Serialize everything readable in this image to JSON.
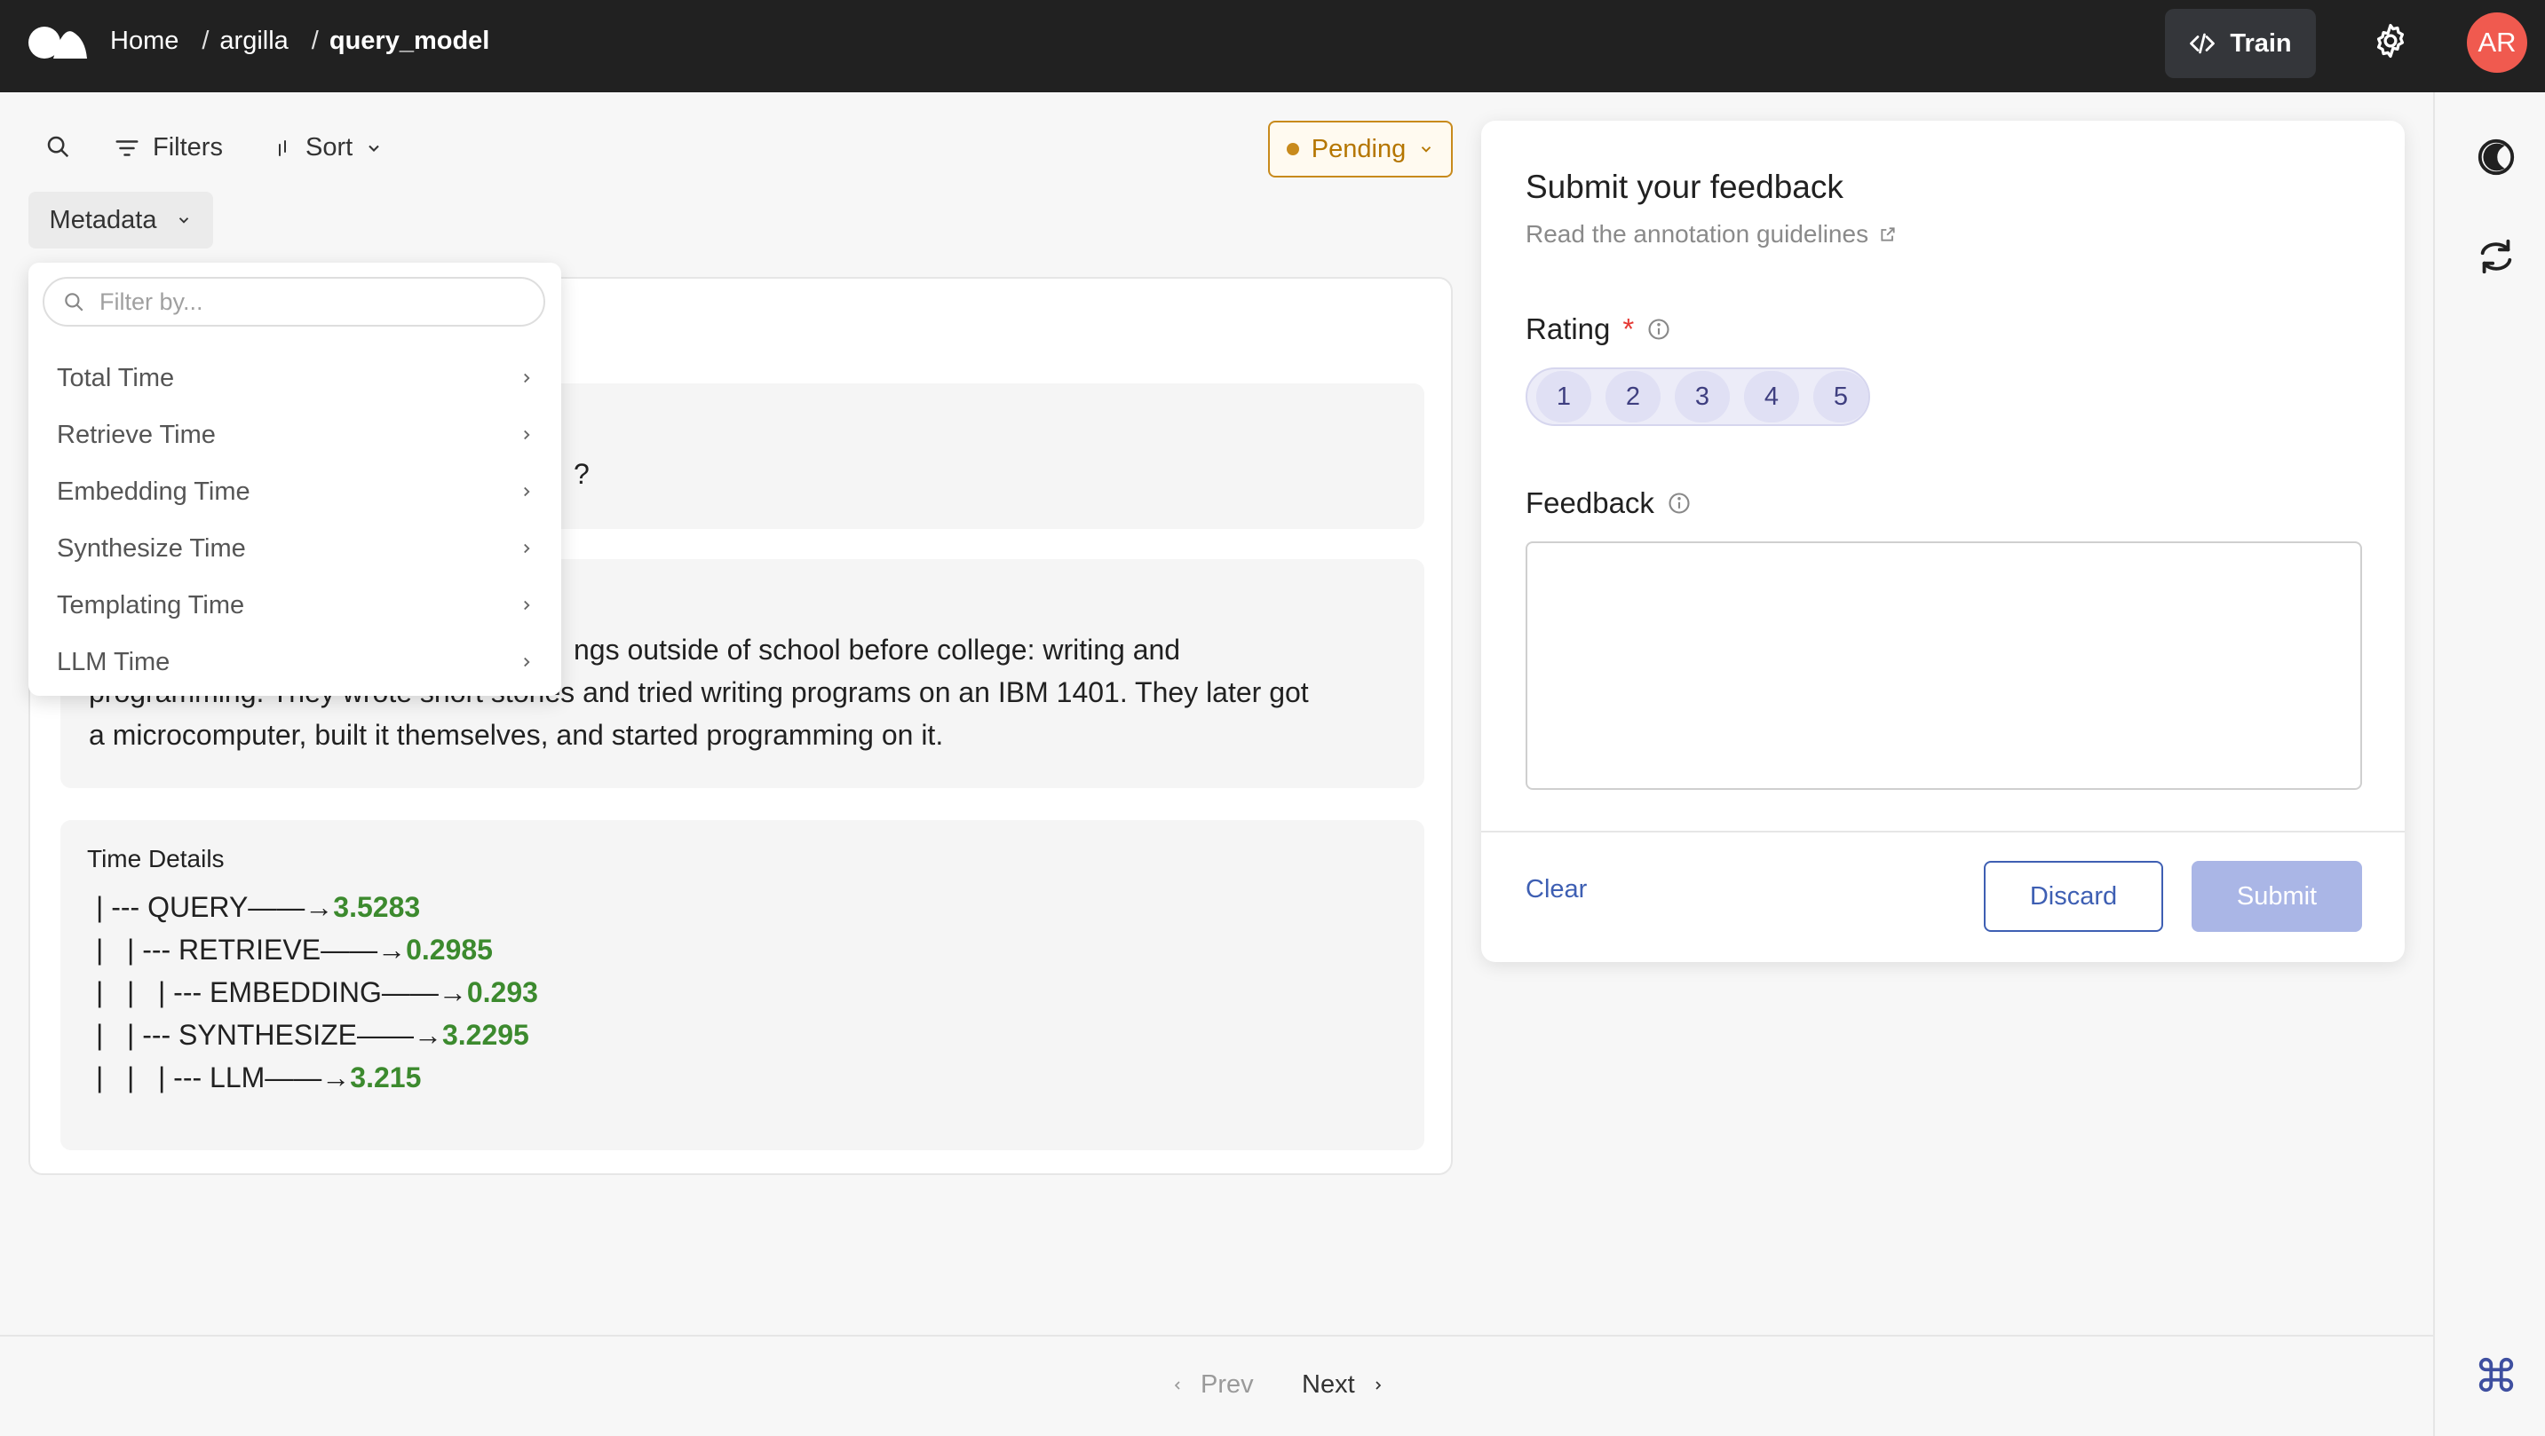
{
  "header": {
    "breadcrumbs": [
      "Home",
      "argilla",
      "query_model"
    ],
    "separator": "/",
    "train_label": "Train",
    "avatar_initials": "AR",
    "colors": {
      "bar": "#212121",
      "avatar": "#f05a4f"
    }
  },
  "toolbar": {
    "filters_label": "Filters",
    "sort_label": "Sort",
    "metadata_label": "Metadata",
    "status_label": "Pending",
    "status_color": "#c88a1c"
  },
  "metadata_menu": {
    "placeholder": "Filter by...",
    "items": [
      {
        "label": "Total Time"
      },
      {
        "label": "Retrieve Time"
      },
      {
        "label": "Embedding Time"
      },
      {
        "label": "Synthesize Time"
      },
      {
        "label": "Templating Time"
      },
      {
        "label": "LLM Time"
      }
    ]
  },
  "record": {
    "query_partial": "?",
    "response_line1": "ngs outside of school before college: writing and",
    "response_line2": "programming. They wrote short stories and tried writing programs on an IBM 1401. They later got",
    "response_line3": "a microcomputer, built it themselves, and started programming on it.",
    "time_details_title": "Time Details",
    "time_tree": [
      {
        "prefix": "| --- QUERY——→",
        "value": "3.5283"
      },
      {
        "prefix": "|   | --- RETRIEVE——→",
        "value": "0.2985"
      },
      {
        "prefix": "|   |   | --- EMBEDDING——→",
        "value": "0.293"
      },
      {
        "prefix": "|   | --- SYNTHESIZE——→",
        "value": "3.2295"
      },
      {
        "prefix": "|   |   | --- LLM——→",
        "value": "3.215"
      }
    ]
  },
  "feedback_panel": {
    "title": "Submit your feedback",
    "guidelines_link": "Read the annotation guidelines",
    "rating_label": "Rating",
    "required_mark": "*",
    "rating_options": [
      "1",
      "2",
      "3",
      "4",
      "5"
    ],
    "feedback_label": "Feedback",
    "feedback_value": "",
    "clear_label": "Clear",
    "discard_label": "Discard",
    "submit_label": "Submit"
  },
  "pagination": {
    "prev_label": "Prev",
    "next_label": "Next"
  },
  "rail_icons": [
    "theme-toggle-icon",
    "refresh-icon",
    "command-icon"
  ]
}
